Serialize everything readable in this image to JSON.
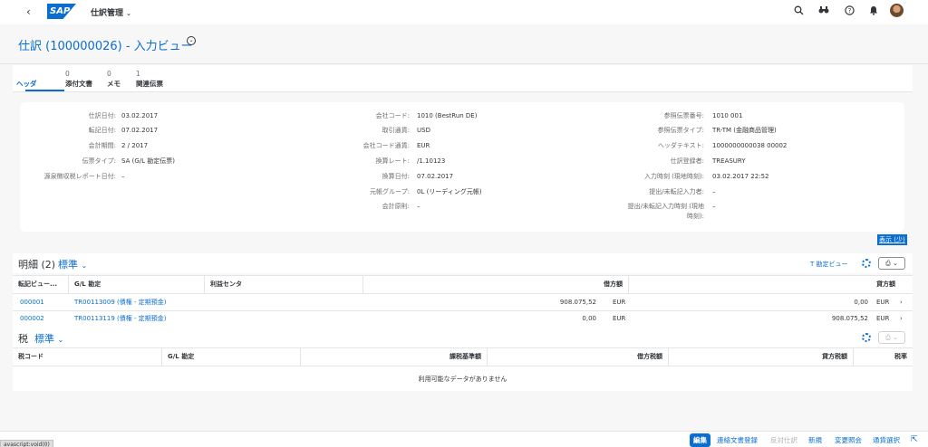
{
  "shell": {
    "back": "‹",
    "logo": "SAP",
    "app_title": "仕訳管理",
    "app_chevron": "⌄"
  },
  "page": {
    "title": "仕訳 (100000026) - 入力ビュー",
    "title_chevron": "⌄"
  },
  "tabs": [
    {
      "count": "",
      "label": "ヘッダ"
    },
    {
      "count": "0",
      "label": "添付文書"
    },
    {
      "count": "0",
      "label": "メモ"
    },
    {
      "count": "1",
      "label": "関連伝票"
    }
  ],
  "header_fields": {
    "col1": [
      {
        "label": "仕訳日付:",
        "value": "03.02.2017"
      },
      {
        "label": "転記日付:",
        "value": "07.02.2017"
      },
      {
        "label": "会計期間:",
        "value": "2 / 2017"
      },
      {
        "label": "伝票タイプ:",
        "value": "SA (G/L 勘定伝票)"
      },
      {
        "label": "源泉徴収税レポート日付:",
        "value": "–"
      }
    ],
    "col2": [
      {
        "label": "会社コード:",
        "value": "1010 (BestRun DE)"
      },
      {
        "label": "取引通貨:",
        "value": "USD"
      },
      {
        "label": "会社コード通貨:",
        "value": "EUR"
      },
      {
        "label": "換算レート:",
        "value": "/1.10123"
      },
      {
        "label": "換算日付:",
        "value": "07.02.2017"
      },
      {
        "label": "元帳グループ:",
        "value": "0L (リーディング元帳)"
      },
      {
        "label": "会計原則:",
        "value": "–"
      }
    ],
    "col3": [
      {
        "label": "参照伝票番号:",
        "value": "1010 001"
      },
      {
        "label": "参照伝票タイプ:",
        "value": "TR-TM (金融商品管理)"
      },
      {
        "label": "ヘッダテキスト:",
        "value": "1000000000038 00002"
      },
      {
        "label": "仕訳登録者:",
        "value": "TREASURY"
      },
      {
        "label": "入力時刻 (現地時刻):",
        "value": "03.02.2017 22:52"
      },
      {
        "label": "提出/未転記入力者:",
        "value": "–"
      },
      {
        "label": "提出/未転記入力時刻 (現地",
        "label2": "時刻):",
        "value": "–"
      }
    ]
  },
  "show_more": "表示 (少)",
  "items_section": {
    "title": "明細 (2)",
    "variant": "標準",
    "variant_chevron": "⌄",
    "t_account_view": "T 勘定ビュー",
    "columns": [
      "転記ビュー...",
      "G/L 勘定",
      "利益センタ",
      "借方額",
      "貸方額"
    ],
    "rows": [
      {
        "item": "000001",
        "gl": "TR00113009 (債権 - 定期預金)",
        "profit_center": "",
        "debit": "908.075,52",
        "debit_cur": "EUR",
        "credit": "0,00",
        "credit_cur": "EUR"
      },
      {
        "item": "000002",
        "gl": "TR00113119 (債権 - 定期預金)",
        "profit_center": "",
        "debit": "0,00",
        "debit_cur": "EUR",
        "credit": "908.075,52",
        "credit_cur": "EUR"
      }
    ]
  },
  "tax_section": {
    "title": "税",
    "variant": "標準",
    "variant_chevron": "⌄",
    "columns": [
      "税コード",
      "G/L 勘定",
      "課税基準額",
      "借方税額",
      "貸方税額",
      "税率"
    ],
    "empty_text": "利用可能なデータがありません"
  },
  "footer": {
    "edit": "編集",
    "link_doc": "連絡文書登録",
    "reverse": "反対仕訳",
    "new": "新規",
    "change_doc": "変更照会",
    "currency": "通貨選択"
  },
  "status_text": "avascript:void(0)",
  "colors": {
    "brand": "#0a6ed1",
    "text": "#32363a",
    "label": "#6a6d70"
  }
}
